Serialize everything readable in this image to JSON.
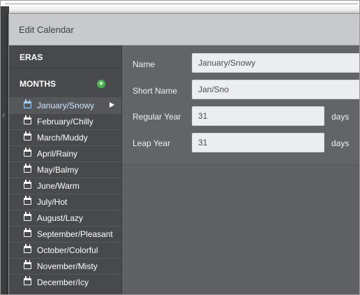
{
  "dialog": {
    "title": "Edit Calendar"
  },
  "sidebar": {
    "eras_label": "ERAS",
    "months_label": "MONTHS",
    "add_icon": "plus-circle-icon",
    "add_color": "#4caf50",
    "months": [
      {
        "label": "January/Snowy",
        "selected": true
      },
      {
        "label": "February/Chilly"
      },
      {
        "label": "March/Muddy"
      },
      {
        "label": "April/Rainy"
      },
      {
        "label": "May/Balmy"
      },
      {
        "label": "June/Warm"
      },
      {
        "label": "July/Hot"
      },
      {
        "label": "August/Lazy"
      },
      {
        "label": "September/Pleasant"
      },
      {
        "label": "October/Colorful"
      },
      {
        "label": "November/Misty"
      },
      {
        "label": "December/Icy"
      }
    ]
  },
  "form": {
    "name_label": "Name",
    "name_value": "January/Snowy",
    "short_name_label": "Short Name",
    "short_name_value": "Jan/Sno",
    "regular_year_label": "Regular Year",
    "regular_year_value": "31",
    "leap_year_label": "Leap Year",
    "leap_year_value": "31",
    "days_unit": "days"
  },
  "background": {
    "fragment": "r"
  }
}
